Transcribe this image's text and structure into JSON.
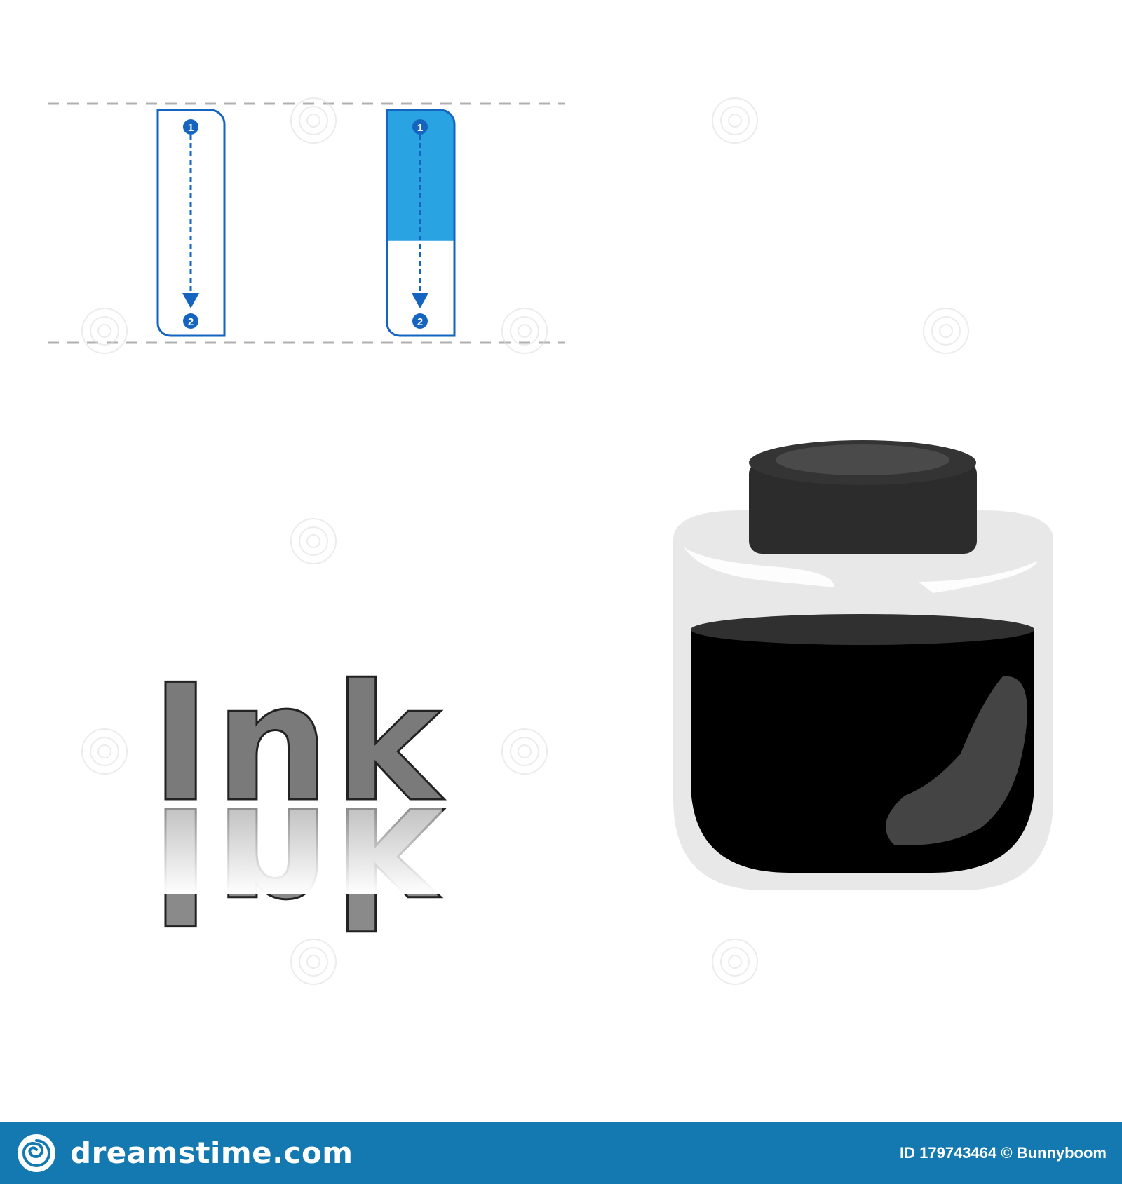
{
  "worksheet": {
    "word": "Ink",
    "stroke_start": "1",
    "stroke_end": "2",
    "trace_fill_level": 0.58
  },
  "colors": {
    "guide_stroke": "#1565c0",
    "guide_fill": "#29a3e1",
    "dash_line": "#b0b0b0",
    "word_fill": "#7a7a7a",
    "word_outline": "#222222",
    "cap": "#2c2c2c",
    "ink": "#000000",
    "jar_glass": "#e8e8e8",
    "footer_bg": "#1479b0"
  },
  "icons": {
    "brand": "spiral-logo-icon",
    "jar": "ink-jar-icon",
    "arrow": "arrow-down-icon"
  },
  "footer": {
    "brand": "dreamstime.com",
    "credit": "ID 179743464 © Bunnyboom"
  }
}
